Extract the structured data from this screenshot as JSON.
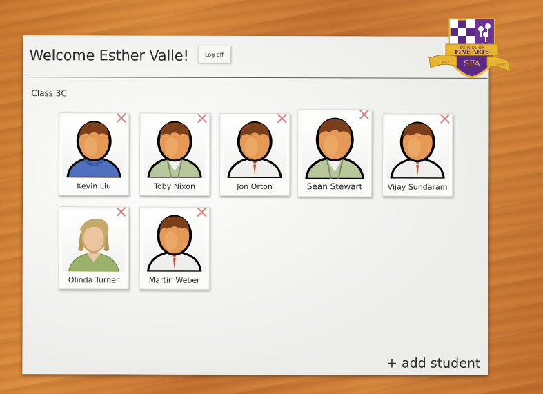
{
  "header": {
    "title": "Welcome Esther Valle!",
    "logoff_label": "Log off"
  },
  "class_name": "Class 3C",
  "students": [
    {
      "name": "Kevin Liu",
      "avatar": "male-blue-sweater"
    },
    {
      "name": "Toby Nixon",
      "avatar": "male-green-jacket"
    },
    {
      "name": "Jon Orton",
      "avatar": "male-tie"
    },
    {
      "name": "Sean Stewart",
      "avatar": "male-green-jacket"
    },
    {
      "name": "Vijay Sundaram",
      "avatar": "male-tie"
    },
    {
      "name": "Olinda Turner",
      "avatar": "female-green-top"
    },
    {
      "name": "Martin Weber",
      "avatar": "male-tie"
    }
  ],
  "add_student_label": "+ add student",
  "logo": {
    "top_text": "SCHOOL OF",
    "middle_text": "FINE ARTS",
    "monogram": "SFA",
    "left_ribbon": "1 9 5 2",
    "right_ribbon": "2 0 1 2",
    "colors": {
      "purple": "#5b2a86",
      "gold": "#e8b530",
      "white": "#ffffff"
    }
  },
  "colors": {
    "skin": "#e49a55",
    "hair_male": "#7a3e1a",
    "hair_female": "#c7a96a",
    "remove_x": "#d77b7b"
  }
}
